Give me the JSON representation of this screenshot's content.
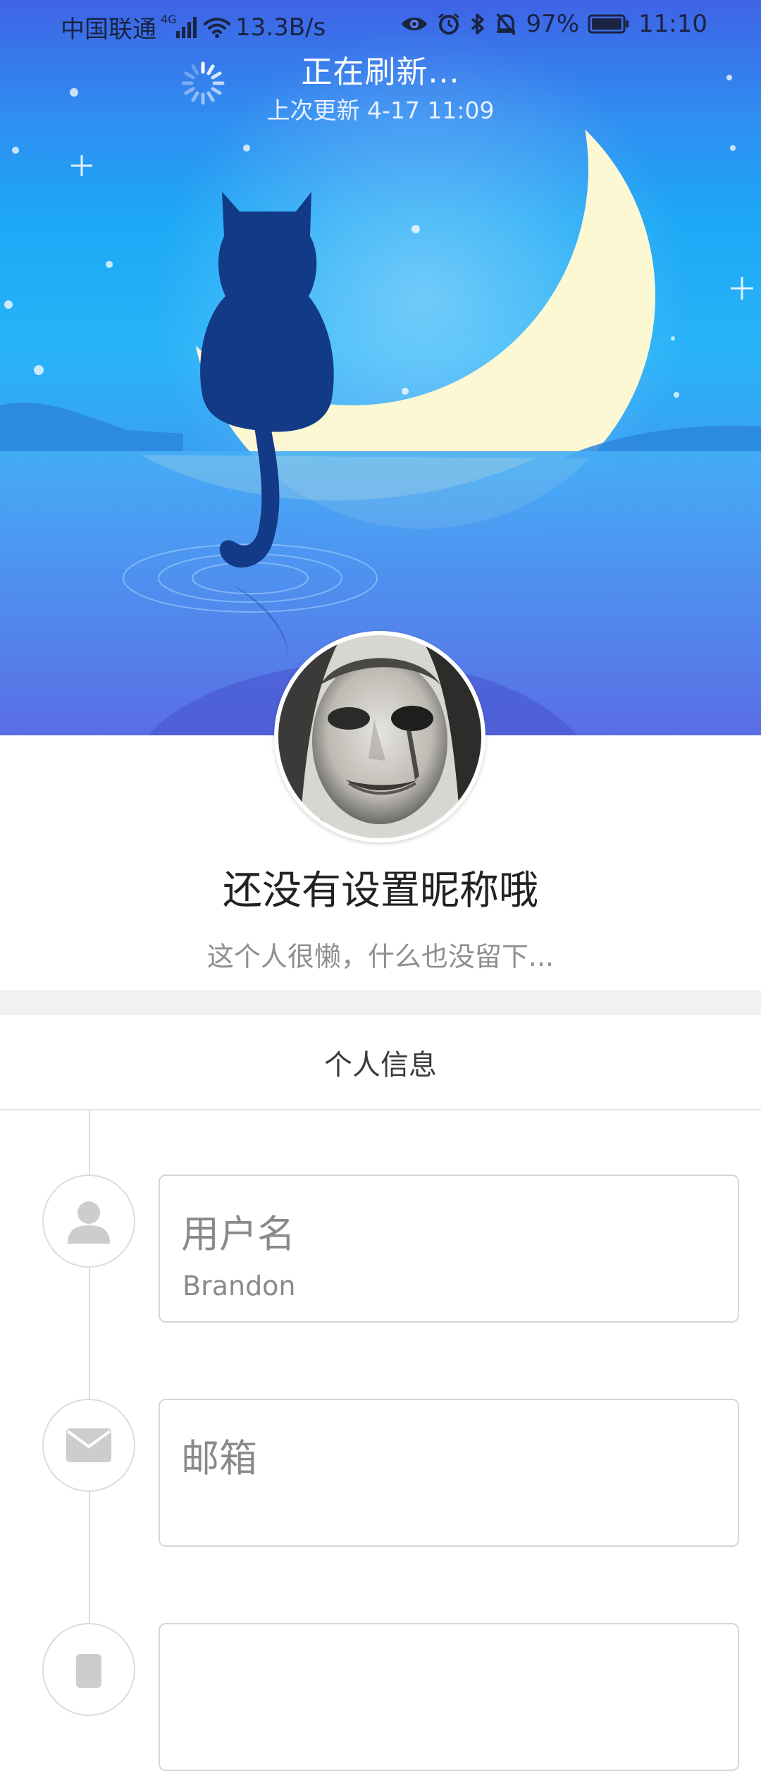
{
  "status_bar": {
    "carrier": "中国联通",
    "network": "4G",
    "speed": "13.3B/s",
    "battery": "97%",
    "time": "11:10",
    "icons": [
      "signal-icon",
      "wifi-icon",
      "eye-icon",
      "alarm-icon",
      "bluetooth-icon",
      "mute-bell-icon",
      "battery-icon"
    ]
  },
  "refresh": {
    "title": "正在刷新...",
    "last_update": "上次更新 4-17 11:09"
  },
  "profile": {
    "nickname": "还没有设置昵称哦",
    "signature": "这个人很懒，什么也没留下..."
  },
  "section": {
    "title": "个人信息"
  },
  "info": {
    "username": {
      "label": "用户名",
      "value": "Brandon",
      "icon": "person-icon"
    },
    "email": {
      "label": "邮箱",
      "value": "",
      "icon": "mail-icon"
    },
    "third": {
      "icon": "phone-icon"
    }
  },
  "colors": {
    "sky_top": "#3f63e6",
    "sky_mid": "#1ca8f6",
    "moon": "#fdf8d4",
    "cat": "#123a86",
    "text_dark": "#222222",
    "text_gray": "#8f8f8f"
  }
}
